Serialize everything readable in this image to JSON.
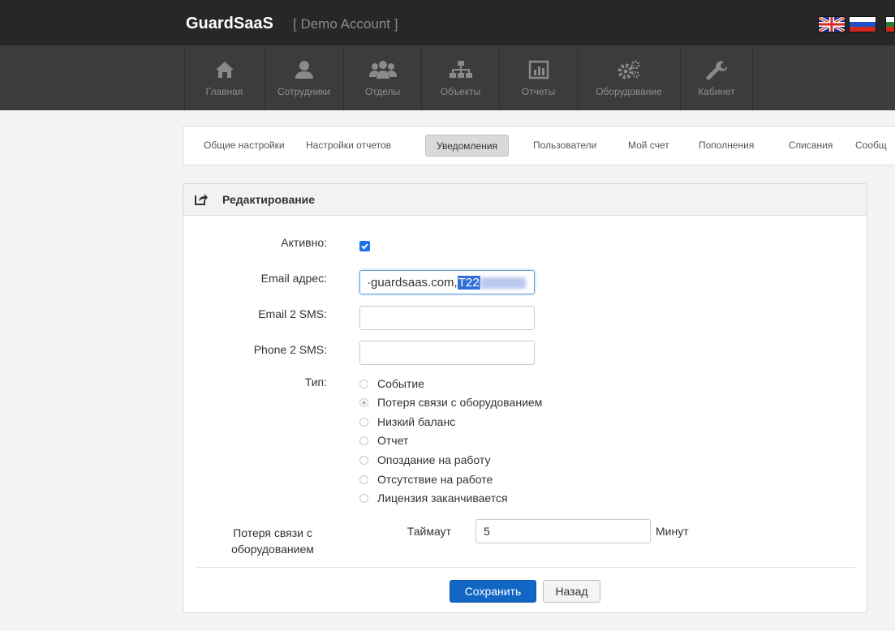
{
  "header": {
    "brand": "GuardSaaS",
    "account": "[ Demo Account ]"
  },
  "languages": [
    {
      "name": "uk-flag-icon"
    },
    {
      "name": "ru-flag-icon"
    },
    {
      "name": "flag-icon"
    }
  ],
  "nav": {
    "items": [
      {
        "label": "Главная",
        "icon": "home-icon"
      },
      {
        "label": "Сотрудники",
        "icon": "user-icon"
      },
      {
        "label": "Отделы",
        "icon": "group-icon"
      },
      {
        "label": "Объекты",
        "icon": "sitemap-icon"
      },
      {
        "label": "Отчеты",
        "icon": "bar-chart-icon"
      },
      {
        "label": "Оборудование",
        "icon": "gears-icon"
      },
      {
        "label": "Кабинет",
        "icon": "wrench-icon"
      }
    ]
  },
  "tabs": [
    {
      "label": "Общие настройки"
    },
    {
      "label": "Настройки отчетов"
    },
    {
      "label": "Уведомления",
      "active": true
    },
    {
      "label": "Пользователи"
    },
    {
      "label": "Мой счет"
    },
    {
      "label": "Пополнения"
    },
    {
      "label": "Списания"
    },
    {
      "label": "Сообщ"
    }
  ],
  "panel": {
    "title": "Редактирование",
    "active_label": "Активно:",
    "active_checked": true,
    "email_label": "Email адрес:",
    "email_value_prefix": "·guardsaas.com,",
    "email_value_selected": "T22",
    "email2sms_label": "Email 2 SMS:",
    "email2sms_value": "",
    "phone2sms_label": "Phone 2 SMS:",
    "phone2sms_value": "",
    "type_label": "Тип:",
    "types": [
      {
        "label": "Событие",
        "selected": false
      },
      {
        "label": "Потеря связи с оборудованием",
        "selected": true
      },
      {
        "label": "Низкий баланс",
        "selected": false
      },
      {
        "label": "Отчет",
        "selected": false
      },
      {
        "label": "Опоздание на работу",
        "selected": false
      },
      {
        "label": "Отсутствие на работе",
        "selected": false
      },
      {
        "label": "Лицензия заканчивается",
        "selected": false
      }
    ],
    "loss_label_line1": "Потеря связи с",
    "loss_label_line2": "оборудованием",
    "timeout_label": "Таймаут",
    "timeout_value": "5",
    "timeout_unit": "Минут",
    "save_label": "Сохранить",
    "back_label": "Назад"
  },
  "colors": {
    "primary": "#1266c4",
    "topbar": "#272727",
    "navbar": "#3c3c3c"
  }
}
